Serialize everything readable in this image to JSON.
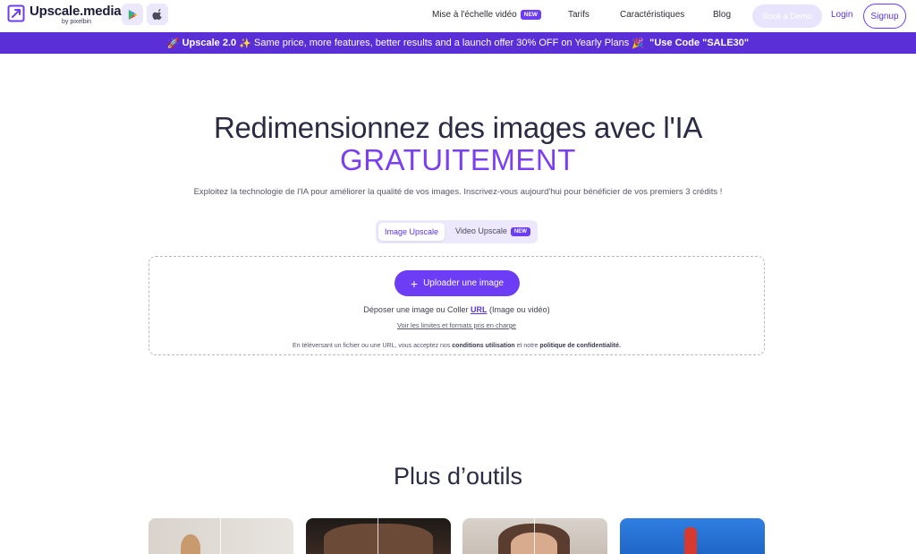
{
  "header": {
    "logo_name": "Upscale.media",
    "logo_sub": "by pixelbin",
    "store_icons": [
      "google-play-icon",
      "apple-icon"
    ],
    "nav": [
      {
        "label": "Mise à l'échelle vidéo",
        "badge": "NEW"
      },
      {
        "label": "Tarifs"
      },
      {
        "label": "Caractéristiques"
      },
      {
        "label": "Blog"
      }
    ],
    "demo_label": "Book a Demo",
    "login_label": "Login",
    "signup_label": "Signup"
  },
  "promo": {
    "emoji_start": "🚀",
    "bold_version": "Upscale 2.0",
    "emoji_mid": "✨",
    "text": "Same price, more features, better results and a launch offer 30% OFF on Yearly Plans",
    "emoji_end": "🎉",
    "code_text": "\"Use Code \"SALE30\""
  },
  "hero": {
    "title": "Redimensionnez des images avec l'IA",
    "accent": "GRATUITEMENT",
    "subtitle": "Exploitez la technologie de l'IA pour améliorer la qualité de vos images. Inscrivez-vous aujourd'hui pour bénéficier de vos premiers 3 crédits !"
  },
  "tabs": {
    "active": "Image Upscale",
    "inactive": "Video Upscale",
    "inactive_badge": "NEW"
  },
  "dropzone": {
    "upload_label": "Uploader une image",
    "drop_before": "Déposer une image ou Coller",
    "drop_url": "URL",
    "drop_after": "(Image ou vidéo)",
    "limits_link": "Voir les limites et formats pris en charge",
    "terms_before": "En téléversant un fichier ou une URL, vous acceptez nos",
    "terms_link1": "conditions utilisation",
    "terms_mid": "et notre",
    "terms_link2": "politique de confidentialité."
  },
  "tools": {
    "title": "Plus d’outils"
  },
  "colors": {
    "accent": "#6c3df4",
    "promo_bg": "#5a2fd8",
    "accent_text": "#7a3ff2"
  }
}
